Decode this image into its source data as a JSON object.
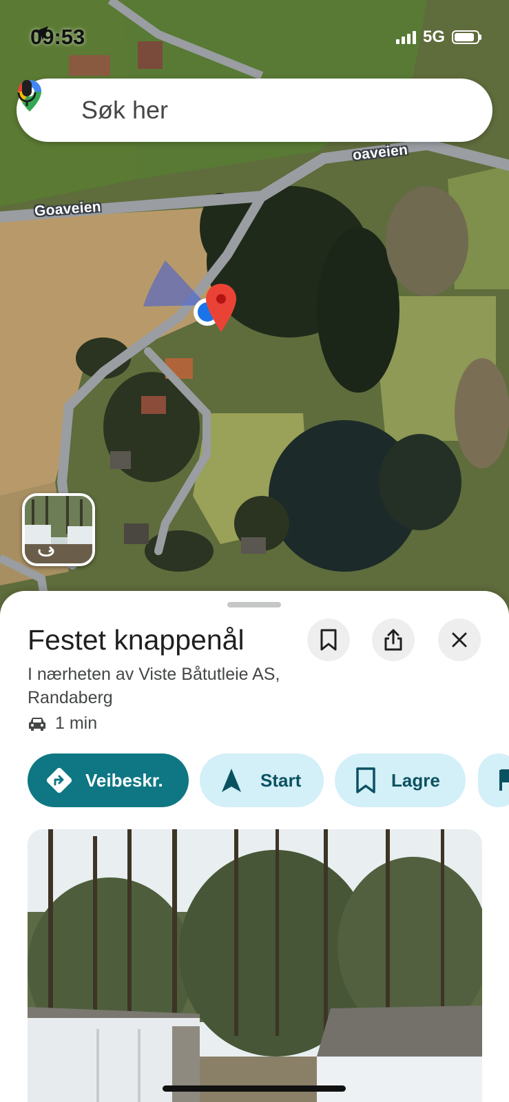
{
  "status_bar": {
    "time": "09:53",
    "network": "5G"
  },
  "search": {
    "placeholder": "Søk her"
  },
  "map": {
    "road_labels": [
      "oaveien",
      "Goaveien"
    ]
  },
  "place": {
    "title": "Festet knappenål",
    "subtitle": "I nærheten av Viste Båtutleie AS, Randaberg",
    "travel_time": "1 min"
  },
  "actions": [
    {
      "label": "Veibeskr.",
      "icon": "directions-icon"
    },
    {
      "label": "Start",
      "icon": "navigation-arrow-icon"
    },
    {
      "label": "Lagre",
      "icon": "bookmark-icon"
    }
  ],
  "colors": {
    "primary": "#0e7783",
    "secondary_chip": "#d3eff8",
    "pin": "#ea4335",
    "location_dot": "#1a73e8"
  }
}
